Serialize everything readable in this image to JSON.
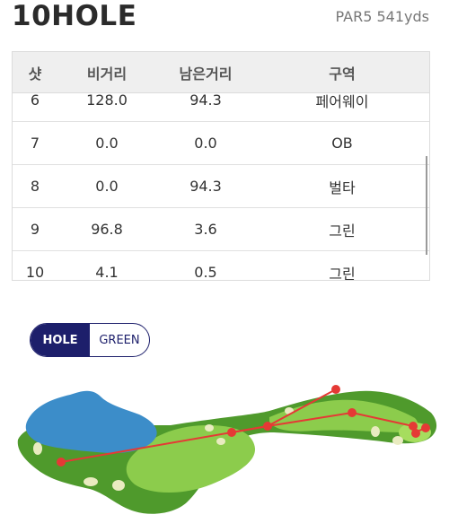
{
  "header": {
    "title": "10HOLE",
    "par_info": "PAR5 541yds"
  },
  "table": {
    "columns": [
      "샷",
      "비거리",
      "남은거리",
      "구역"
    ],
    "rows": [
      [
        "6",
        "128.0",
        "94.3",
        "페어웨이"
      ],
      [
        "7",
        "0.0",
        "0.0",
        "OB"
      ],
      [
        "8",
        "0.0",
        "94.3",
        "벌타"
      ],
      [
        "9",
        "96.8",
        "3.6",
        "그린"
      ],
      [
        "10",
        "4.1",
        "0.5",
        "그린"
      ]
    ]
  },
  "view_toggle": {
    "hole": "HOLE",
    "green": "GREEN",
    "selected": "HOLE"
  },
  "colors": {
    "accent": "#1d1f6b",
    "shot_line": "#e53935",
    "fairway": "#7cbf3f",
    "rough": "#4f9a2c",
    "water": "#3c8dc9"
  }
}
